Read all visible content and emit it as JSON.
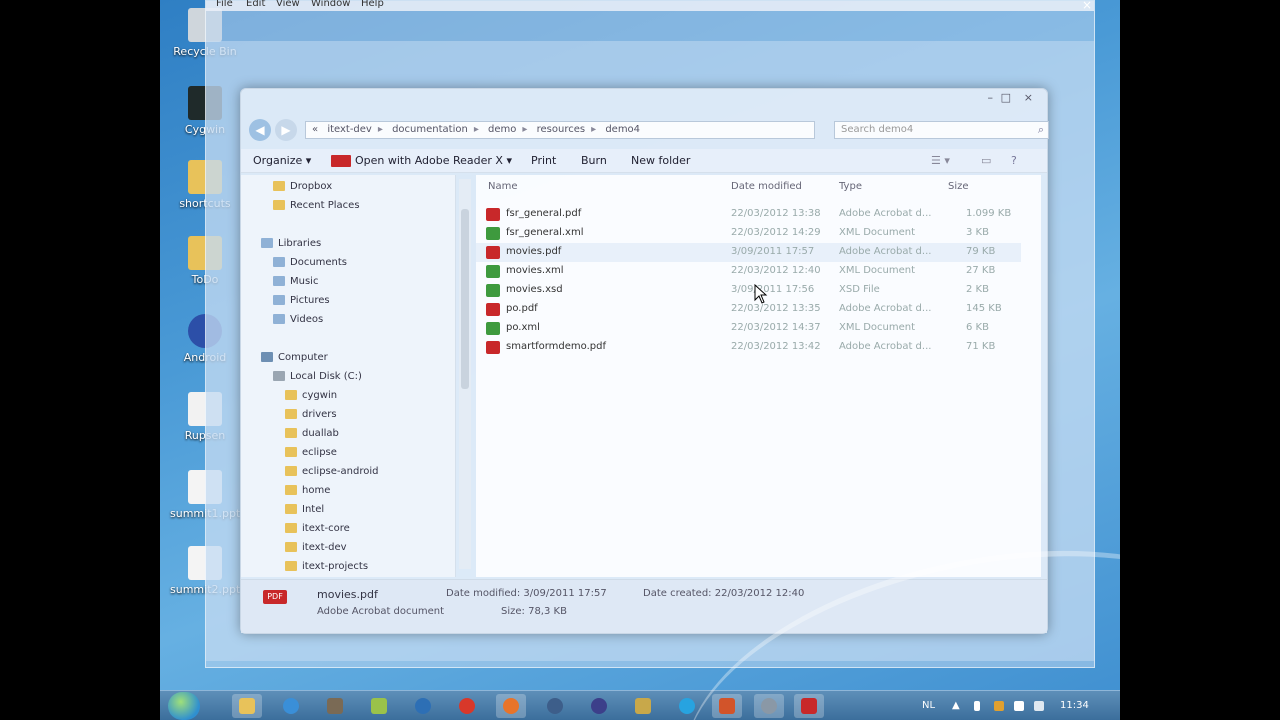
{
  "desktop": {
    "icons": [
      "Recycle Bin",
      "Cygwin",
      "shortcuts",
      "ToDo",
      "Android",
      "Rupsen",
      "summit1.ppt",
      "summit2.ppt"
    ]
  },
  "background_window": {
    "menu": [
      "File",
      "Edit",
      "View",
      "Window",
      "Help"
    ],
    "close": "×"
  },
  "explorer": {
    "window_controls": [
      "–",
      "□",
      "×"
    ],
    "address": {
      "crumbs": [
        "«",
        "itext-dev",
        "documentation",
        "demo",
        "resources",
        "demo4"
      ],
      "separator": "▸"
    },
    "search_placeholder": "Search demo4",
    "toolbar": {
      "organize": "Organize ▾",
      "open_with": "Open with Adobe Reader X ▾",
      "print": "Print",
      "burn": "Burn",
      "new_folder": "New folder"
    },
    "nav": {
      "dropbox": "Dropbox",
      "recent": "Recent Places",
      "libraries": "Libraries",
      "documents": "Documents",
      "music": "Music",
      "pictures": "Pictures",
      "videos": "Videos",
      "computer": "Computer",
      "local_disk": "Local Disk (C:)",
      "folders": [
        "cygwin",
        "drivers",
        "duallab",
        "eclipse",
        "eclipse-android",
        "home",
        "Intel",
        "itext-core",
        "itext-dev",
        "itext-projects"
      ]
    },
    "columns": {
      "name": "Name",
      "date": "Date modified",
      "type": "Type",
      "size": "Size"
    },
    "files": [
      {
        "name": "fsr_general.pdf",
        "date": "22/03/2012 13:38",
        "type": "Adobe Acrobat d...",
        "size": "1.099 KB",
        "kind": "pdf"
      },
      {
        "name": "fsr_general.xml",
        "date": "22/03/2012 14:29",
        "type": "XML Document",
        "size": "3 KB",
        "kind": "xml"
      },
      {
        "name": "movies.pdf",
        "date": "3/09/2011 17:57",
        "type": "Adobe Acrobat d...",
        "size": "79 KB",
        "kind": "pdf"
      },
      {
        "name": "movies.xml",
        "date": "22/03/2012 12:40",
        "type": "XML Document",
        "size": "27 KB",
        "kind": "xml"
      },
      {
        "name": "movies.xsd",
        "date": "3/09/2011 17:56",
        "type": "XSD File",
        "size": "2 KB",
        "kind": "xsd"
      },
      {
        "name": "po.pdf",
        "date": "22/03/2012 13:35",
        "type": "Adobe Acrobat d...",
        "size": "145 KB",
        "kind": "pdf"
      },
      {
        "name": "po.xml",
        "date": "22/03/2012 14:37",
        "type": "XML Document",
        "size": "6 KB",
        "kind": "xml"
      },
      {
        "name": "smartformdemo.pdf",
        "date": "22/03/2012 13:42",
        "type": "Adobe Acrobat d...",
        "size": "71 KB",
        "kind": "pdf"
      }
    ],
    "details": {
      "icon_label": "PDF",
      "filename": "movies.pdf",
      "filetype": "Adobe Acrobat document",
      "date_modified": "Date modified: 3/09/2011 17:57",
      "date_created": "Date created: 22/03/2012 12:40",
      "size": "Size: 78,3 KB"
    }
  },
  "taskbar": {
    "language": "NL",
    "clock": "11:34"
  },
  "colors": {
    "pdf": "#c8282a",
    "xml": "#3e9a3e",
    "desktop": "#4a9ad6"
  }
}
